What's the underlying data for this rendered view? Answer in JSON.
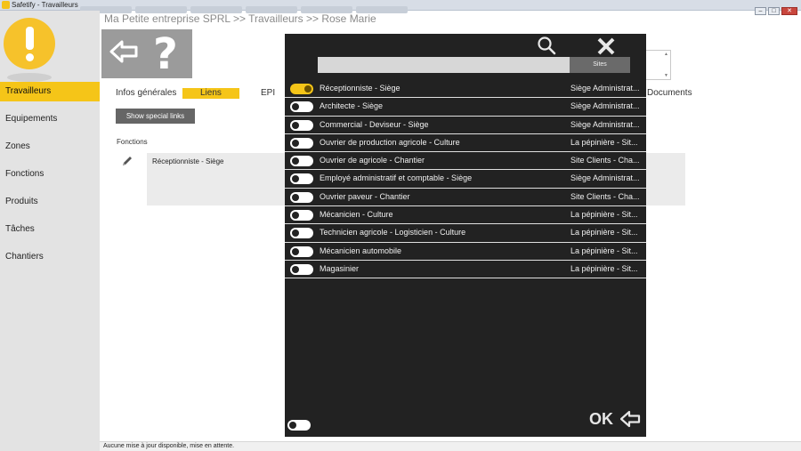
{
  "window": {
    "title": "Safetify - Travailleurs",
    "minimize": "–",
    "maximize": "□",
    "close": "✕"
  },
  "sidebar": {
    "items": [
      {
        "label": "Travailleurs",
        "active": true
      },
      {
        "label": "Equipements"
      },
      {
        "label": "Zones"
      },
      {
        "label": "Fonctions"
      },
      {
        "label": "Produits"
      },
      {
        "label": "Tâches"
      },
      {
        "label": "Chantiers"
      }
    ]
  },
  "breadcrumb": "Ma Petite entreprise SPRL >> Travailleurs >> Rose Marie",
  "tabs": [
    {
      "label": "Infos générales"
    },
    {
      "label": "Liens",
      "active": true
    },
    {
      "label": "EPI"
    }
  ],
  "tab_documents": "Documents",
  "special_links_button": "Show special links",
  "fonctions_label": "Fonctions",
  "fonction_selected": "Réceptionniste - Siège",
  "status": "Aucune mise à jour disponible, mise en attente.",
  "modal": {
    "search_placeholder": "",
    "sites_button": "Sites",
    "ok_label": "OK",
    "rows": [
      {
        "name": "Réceptionniste - Siège",
        "site": "Siège Administrat...",
        "on": true
      },
      {
        "name": "Architecte - Siège",
        "site": "Siège Administrat...",
        "on": false
      },
      {
        "name": "Commercial - Deviseur - Siège",
        "site": "Siège Administrat...",
        "on": false
      },
      {
        "name": "Ouvrier de production agricole - Culture",
        "site": "La pépinière - Sit...",
        "on": false
      },
      {
        "name": "Ouvrier de agricole - Chantier",
        "site": "Site Clients - Cha...",
        "on": false
      },
      {
        "name": "Employé administratif et comptable - Siège",
        "site": "Siège Administrat...",
        "on": false
      },
      {
        "name": "Ouvrier paveur - Chantier",
        "site": "Site Clients - Cha...",
        "on": false
      },
      {
        "name": "Mécanicien - Culture",
        "site": "La pépinière - Sit...",
        "on": false
      },
      {
        "name": "Technicien agricole - Logisticien - Culture",
        "site": "La pépinière - Sit...",
        "on": false
      },
      {
        "name": "Mécanicien automobile",
        "site": "La pépinière - Sit...",
        "on": false
      },
      {
        "name": "Magasinier",
        "site": "La pépinière - Sit...",
        "on": false
      }
    ]
  },
  "colors": {
    "accent": "#f5c518",
    "modal_bg": "#222222",
    "sidebar_bg": "#e3e3e3"
  }
}
